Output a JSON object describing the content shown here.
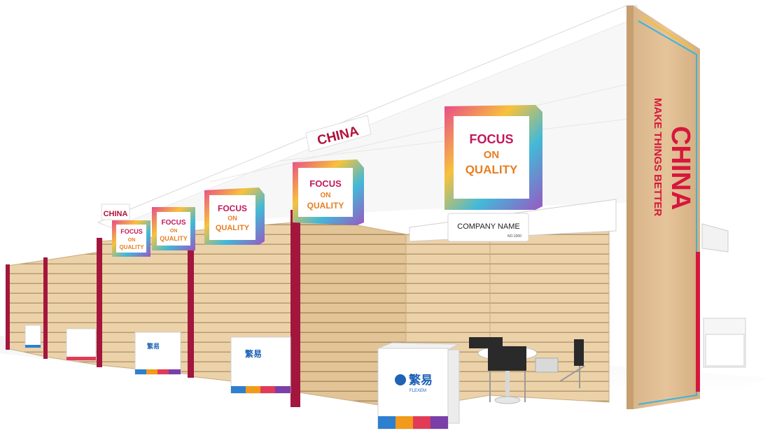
{
  "signs": {
    "ceiling_fascia": "CHINA",
    "left_fascia": "CHINA",
    "pillar_brand": "CHINA",
    "pillar_slogan": "MAKE  THINGS BETTER",
    "company_name": "COMPANY NAME",
    "booth_number": "NO.1000"
  },
  "cubes": {
    "line1": "FOCUS",
    "line2": "ON",
    "line3": "QUALITY"
  },
  "counter": {
    "brand_cn": "繁易",
    "brand_en": "FLEXEM"
  },
  "colors": {
    "accent_maroon": "#a3163e",
    "brand_red": "#d6173d",
    "wood": "#e9cfa6",
    "blue_logo": "#1e63b6",
    "stripe": [
      "#2d7fd0",
      "#f29a1a",
      "#e23b57",
      "#7a3fa8"
    ]
  }
}
